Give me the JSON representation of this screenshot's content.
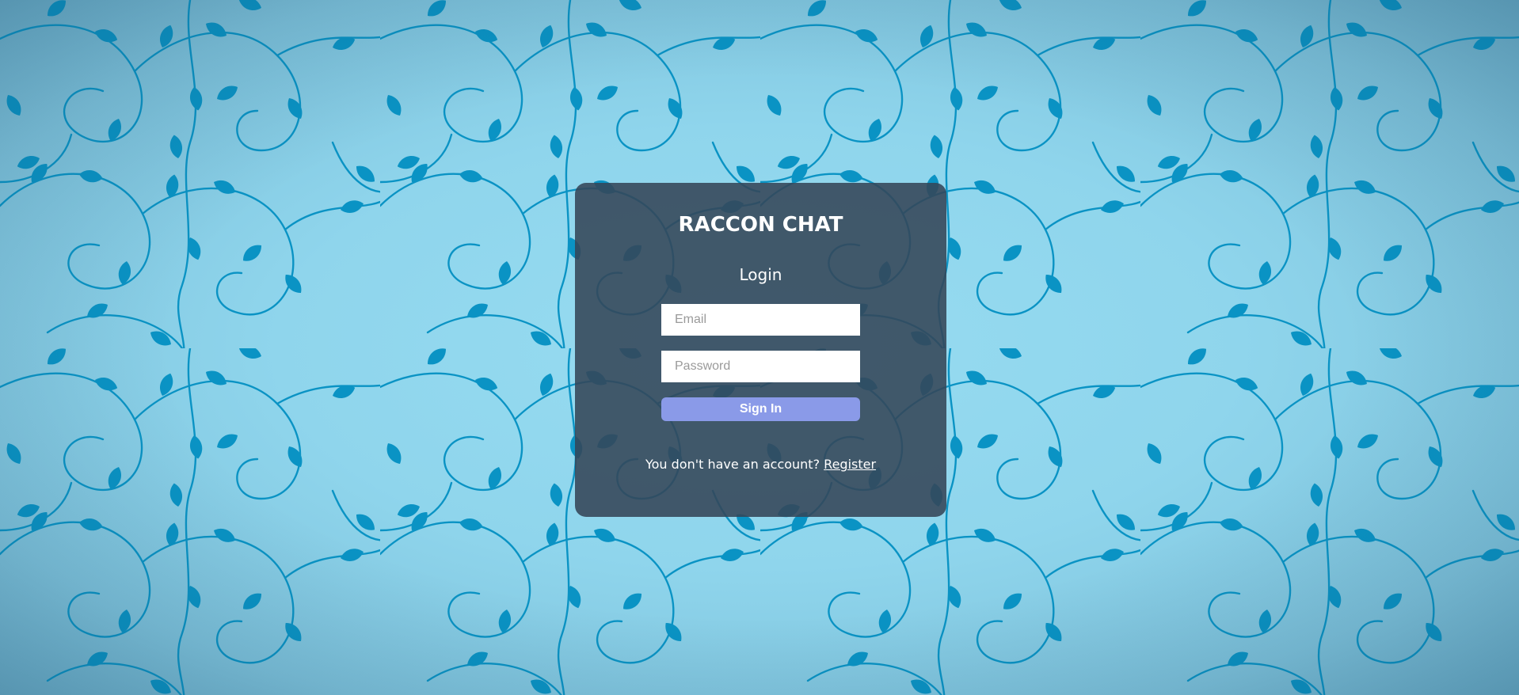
{
  "app": {
    "title": "RACCON CHAT",
    "subtitle": "Login"
  },
  "form": {
    "email": {
      "value": "",
      "placeholder": "Email"
    },
    "password": {
      "value": "",
      "placeholder": "Password"
    },
    "submit_label": "Sign In"
  },
  "footer": {
    "prompt": "You don't have an account?",
    "link_label": "Register"
  },
  "colors": {
    "background": "#8fd5ec",
    "vine": "#0a93c4",
    "card": "#344658",
    "button": "#8a9ae8"
  }
}
